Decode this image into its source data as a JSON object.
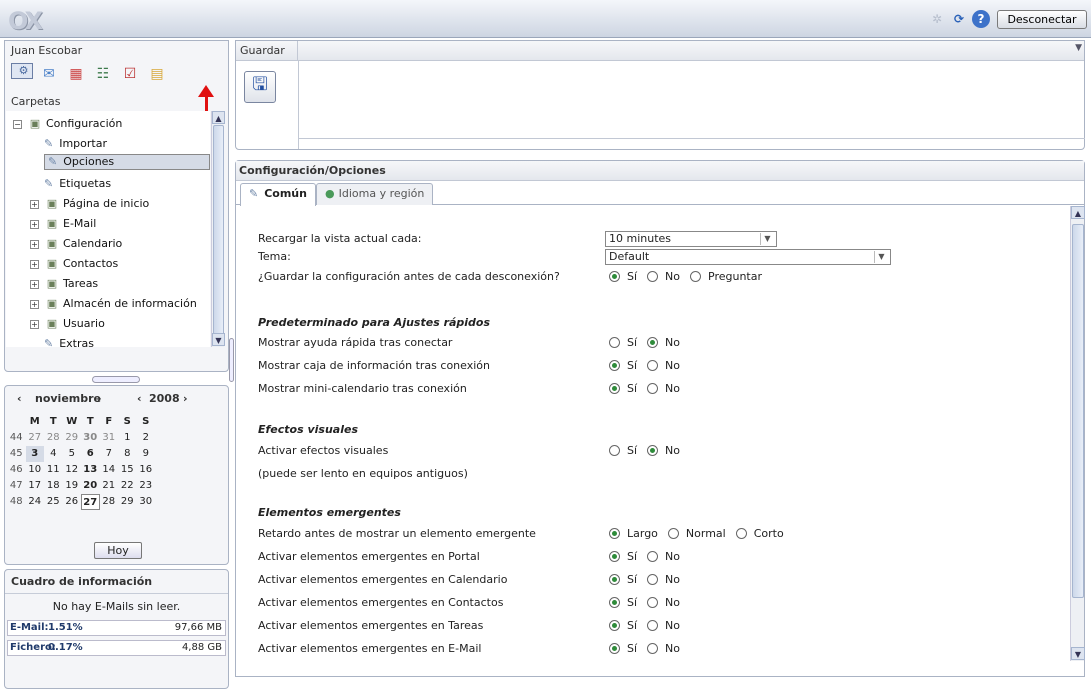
{
  "topbar": {
    "logo": "OX",
    "logout_label": "Desconectar",
    "icons": [
      "activity-icon",
      "refresh-icon",
      "help-icon"
    ]
  },
  "sidebar": {
    "username": "Juan Escobar",
    "apps": [
      "portal-icon",
      "mail-icon",
      "calendar-icon",
      "contacts-icon",
      "tasks-icon",
      "infostore-icon",
      "configuration-icon"
    ],
    "folders_label": "Carpetas",
    "tree": [
      {
        "label": "Configuración",
        "level": 0,
        "expander": "−",
        "type": "folder"
      },
      {
        "label": "Importar",
        "level": 1,
        "type": "setting"
      },
      {
        "label": "Opciones",
        "level": 1,
        "type": "setting",
        "selected": true
      },
      {
        "label": "Etiquetas",
        "level": 1,
        "type": "setting"
      },
      {
        "label": "Página de inicio",
        "level": 1,
        "expander": "+",
        "type": "folder"
      },
      {
        "label": "E-Mail",
        "level": 1,
        "expander": "+",
        "type": "folder"
      },
      {
        "label": "Calendario",
        "level": 1,
        "expander": "+",
        "type": "folder"
      },
      {
        "label": "Contactos",
        "level": 1,
        "expander": "+",
        "type": "folder"
      },
      {
        "label": "Tareas",
        "level": 1,
        "expander": "+",
        "type": "folder"
      },
      {
        "label": "Almacén de información",
        "level": 1,
        "expander": "+",
        "type": "folder"
      },
      {
        "label": "Usuario",
        "level": 1,
        "expander": "+",
        "type": "folder"
      },
      {
        "label": "Extras",
        "level": 1,
        "type": "setting"
      }
    ]
  },
  "calendar": {
    "month": "noviembre",
    "year": "2008",
    "prev": "‹",
    "next": "›",
    "weekdays": [
      "M",
      "T",
      "W",
      "T",
      "F",
      "S",
      "S"
    ],
    "weeks": [
      {
        "wk": "44",
        "days": [
          "27",
          "28",
          "29",
          "30",
          "31",
          "1",
          "2"
        ]
      },
      {
        "wk": "45",
        "days": [
          "3",
          "4",
          "5",
          "6",
          "7",
          "8",
          "9"
        ]
      },
      {
        "wk": "46",
        "days": [
          "10",
          "11",
          "12",
          "13",
          "14",
          "15",
          "16"
        ]
      },
      {
        "wk": "47",
        "days": [
          "17",
          "18",
          "19",
          "20",
          "21",
          "22",
          "23"
        ]
      },
      {
        "wk": "48",
        "days": [
          "24",
          "25",
          "26",
          "27",
          "28",
          "29",
          "30"
        ]
      }
    ],
    "today_label": "Hoy"
  },
  "info": {
    "title": "Cuadro de información",
    "no_mail": "No hay E-Mails sin leer.",
    "quotas": [
      {
        "label": "E-Mail:",
        "percent": "1.51%",
        "size": "97,66 MB"
      },
      {
        "label": "Fichero:",
        "percent": "0.17%",
        "size": "4,88 GB"
      }
    ]
  },
  "toolbar": {
    "save_label": "Guardar"
  },
  "main": {
    "title": "Configuración/Opciones",
    "tabs": [
      {
        "label": "Común",
        "active": true
      },
      {
        "label": "Idioma y región",
        "active": false
      }
    ],
    "reload_label": "Recargar la vista actual cada:",
    "reload_value": "10 minutes",
    "theme_label": "Tema:",
    "theme_value": "Default",
    "save_config_label": "¿Guardar la configuración antes de cada desconexión?",
    "save_config_options": [
      "Sí",
      "No",
      "Preguntar"
    ],
    "save_config_selected": "Sí",
    "sections": [
      {
        "header": "Predeterminado para Ajustes rápidos",
        "rows": [
          {
            "label": "Mostrar ayuda rápida tras conectar",
            "options": [
              "Sí",
              "No"
            ],
            "selected": "No"
          },
          {
            "label": "Mostrar caja de información tras conexión",
            "options": [
              "Sí",
              "No"
            ],
            "selected": "Sí"
          },
          {
            "label": "Mostrar mini-calendario tras conexión",
            "options": [
              "Sí",
              "No"
            ],
            "selected": "Sí"
          }
        ]
      },
      {
        "header": "Efectos visuales",
        "rows": [
          {
            "label": "Activar efectos visuales",
            "options": [
              "Sí",
              "No"
            ],
            "selected": "No"
          },
          {
            "label": "(puede ser lento en equipos antiguos)",
            "options": [],
            "selected": ""
          }
        ]
      },
      {
        "header": "Elementos emergentes",
        "rows": [
          {
            "label": "Retardo antes de mostrar un elemento emergente",
            "options": [
              "Largo",
              "Normal",
              "Corto"
            ],
            "selected": "Largo"
          },
          {
            "label": "Activar elementos emergentes en Portal",
            "options": [
              "Sí",
              "No"
            ],
            "selected": "Sí"
          },
          {
            "label": "Activar elementos emergentes en Calendario",
            "options": [
              "Sí",
              "No"
            ],
            "selected": "Sí"
          },
          {
            "label": "Activar elementos emergentes en Contactos",
            "options": [
              "Sí",
              "No"
            ],
            "selected": "Sí"
          },
          {
            "label": "Activar elementos emergentes en Tareas",
            "options": [
              "Sí",
              "No"
            ],
            "selected": "Sí"
          },
          {
            "label": "Activar elementos emergentes en E-Mail",
            "options": [
              "Sí",
              "No"
            ],
            "selected": "Sí"
          }
        ]
      }
    ]
  }
}
